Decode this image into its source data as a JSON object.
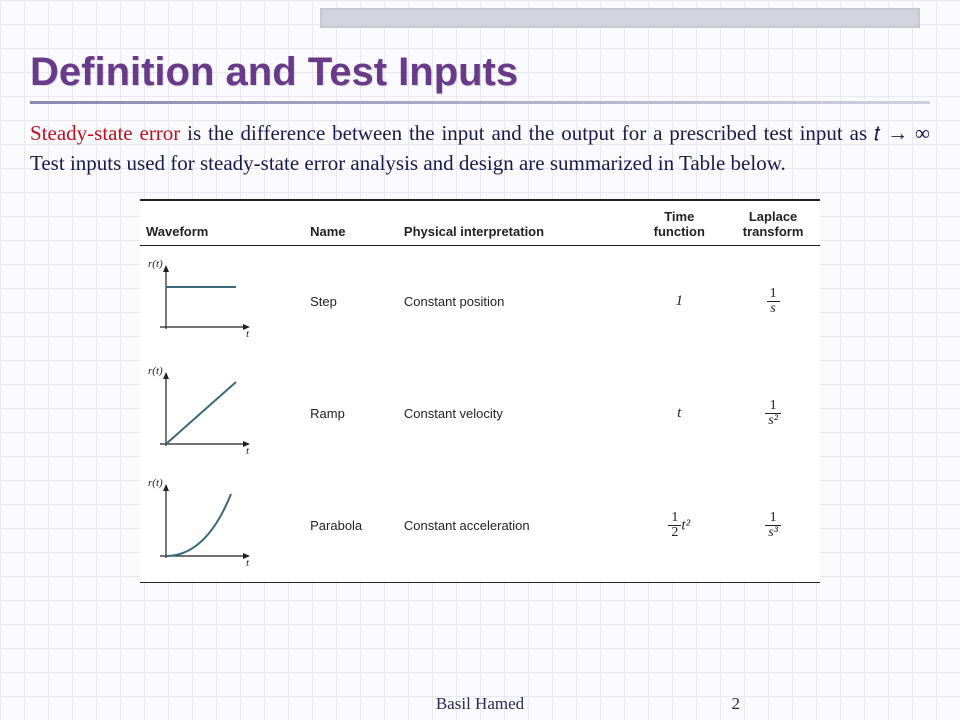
{
  "slide": {
    "title": "Definition and Test Inputs",
    "body_red": "Steady-state error",
    "body_rest": " is the difference between the input and the output for a prescribed test input as 𝑡 → ∞ Test inputs used for steady-state error analysis and design are summarized in Table below."
  },
  "table": {
    "headers": {
      "waveform": "Waveform",
      "name": "Name",
      "interpretation": "Physical interpretation",
      "time_function": "Time function",
      "laplace": "Laplace transform"
    },
    "axis_y": "r(t)",
    "axis_x": "t",
    "rows": [
      {
        "name": "Step",
        "interpretation": "Constant position",
        "time_fn": "1",
        "laplace_num": "1",
        "laplace_den": "s"
      },
      {
        "name": "Ramp",
        "interpretation": "Constant velocity",
        "time_fn": "t",
        "laplace_num": "1",
        "laplace_den": "s²"
      },
      {
        "name": "Parabola",
        "interpretation": "Constant acceleration",
        "time_fn_num": "1",
        "time_fn_den": "2",
        "time_fn_post": "t²",
        "laplace_num": "1",
        "laplace_den": "s³"
      }
    ]
  },
  "footer": {
    "author": "Basil Hamed",
    "page": "2"
  }
}
